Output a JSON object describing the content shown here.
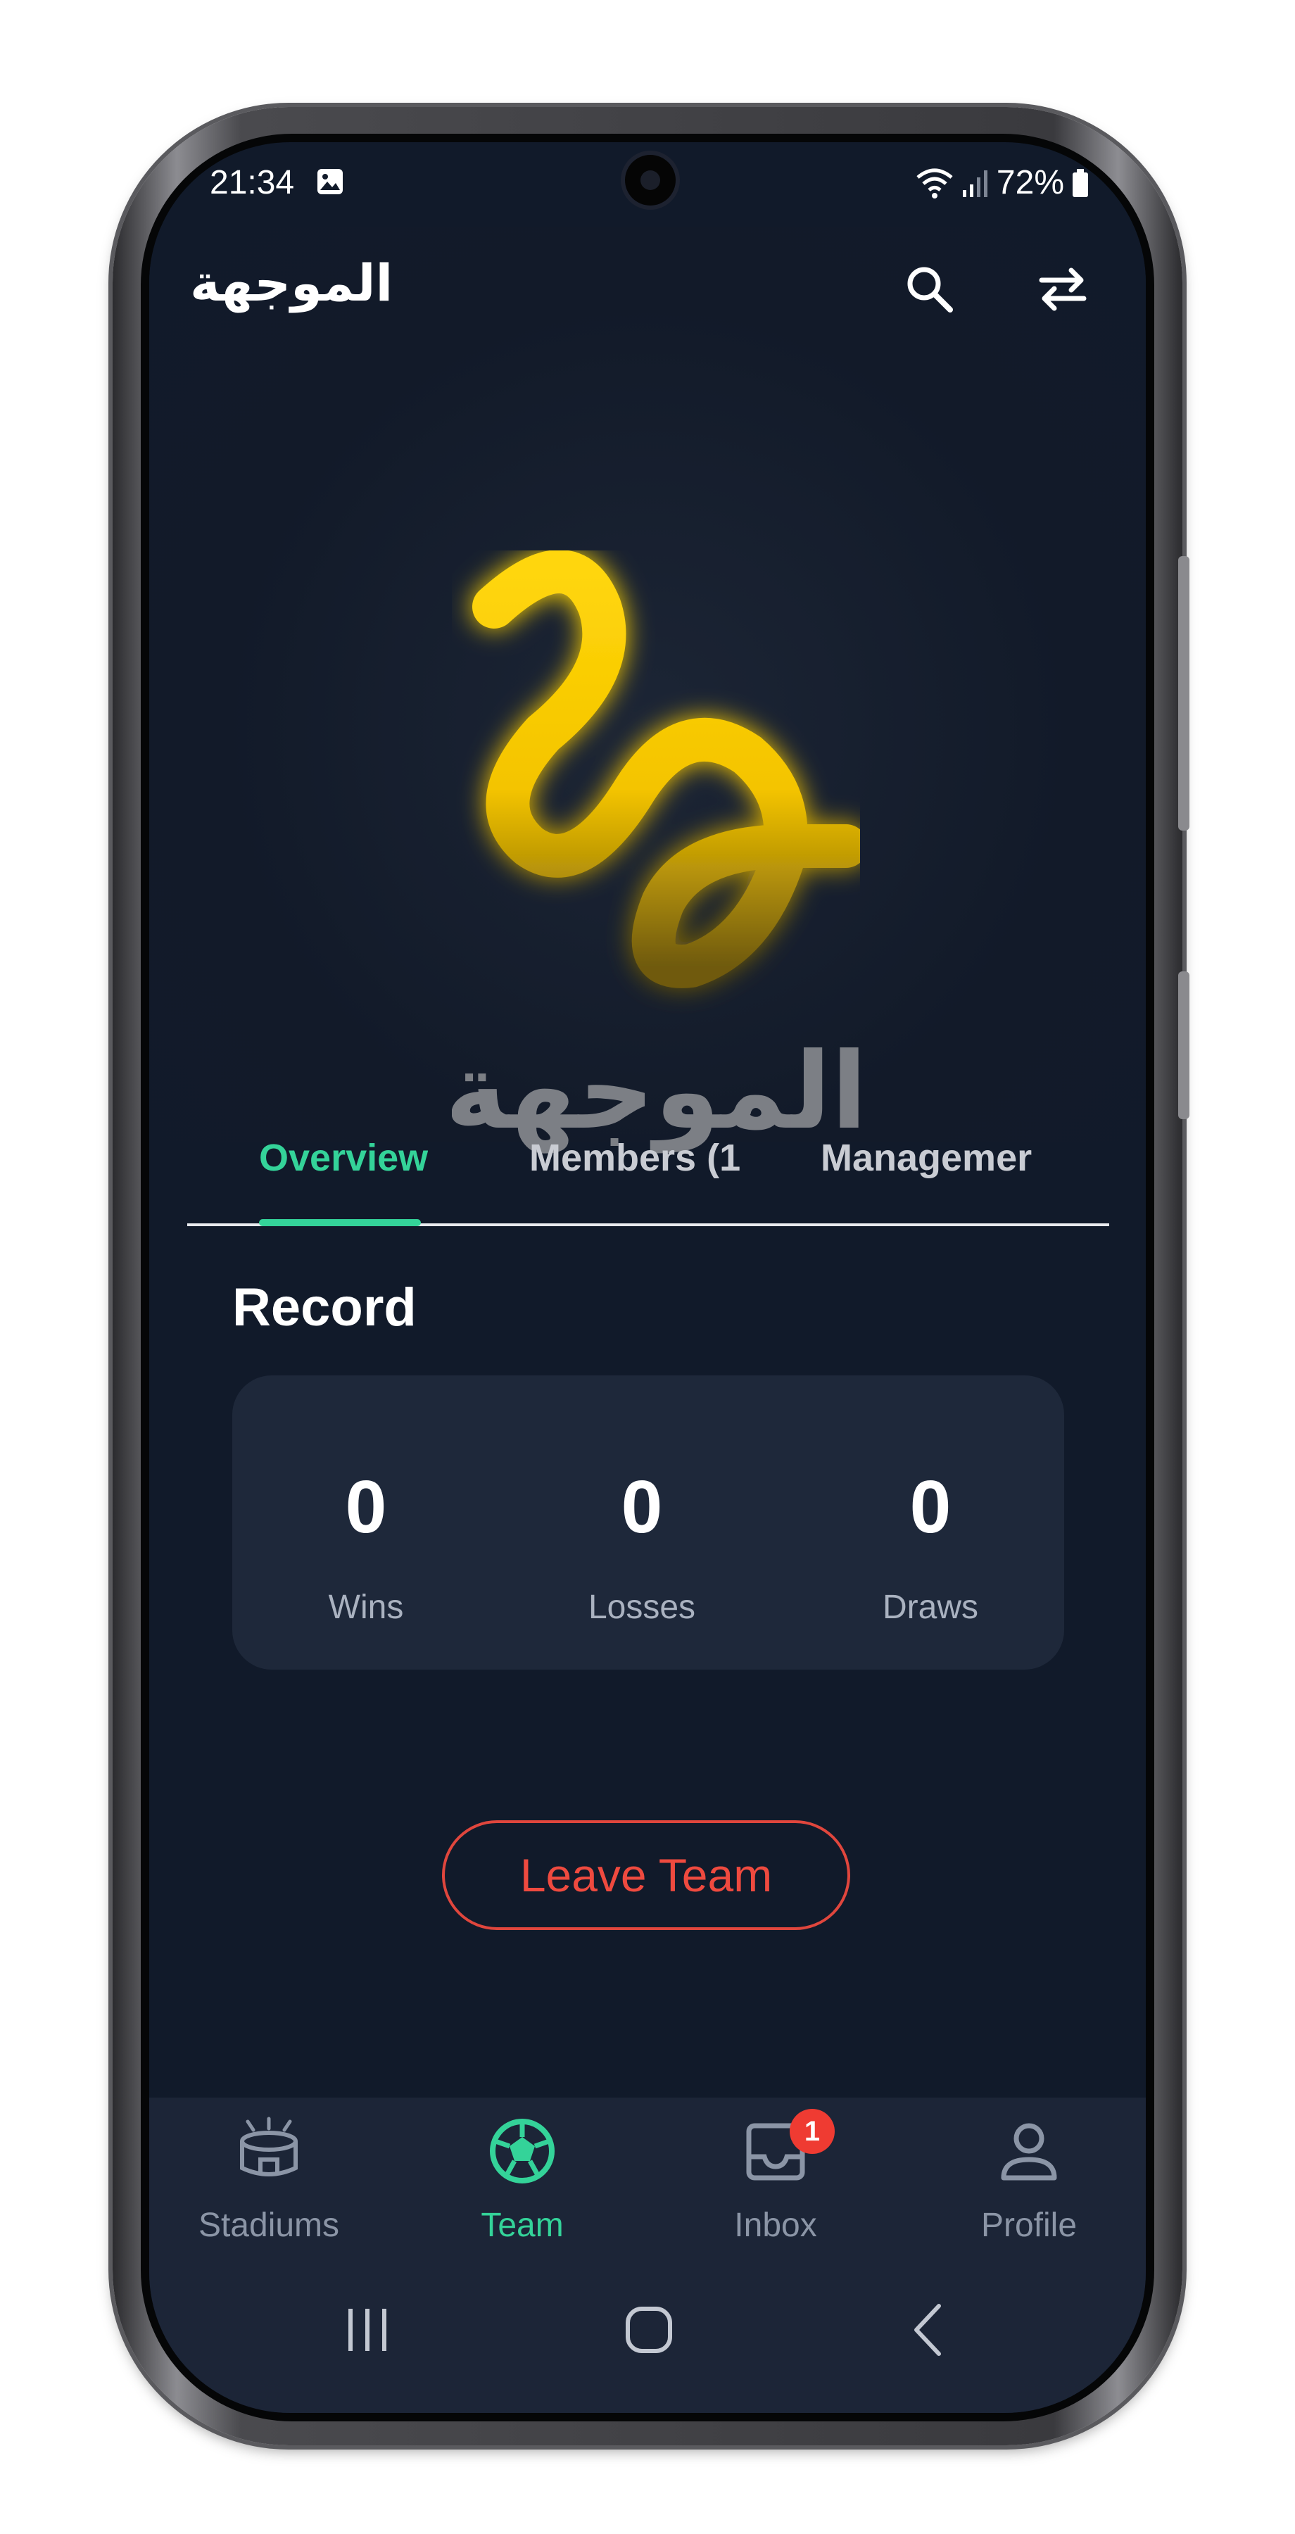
{
  "status_bar": {
    "time": "21:34",
    "battery": "72%"
  },
  "app_bar": {
    "title": "الموجهة",
    "icons": [
      "search-icon",
      "swap-icon"
    ]
  },
  "team_logo": {
    "text": "الموجهة",
    "colors": {
      "yellow": "#f4c700",
      "gray": "#7c7f85"
    }
  },
  "tabs": [
    {
      "label": "Overview",
      "active": true
    },
    {
      "label": "Members (1",
      "active": false
    },
    {
      "label": "Managemer",
      "active": false
    }
  ],
  "record": {
    "title": "Record",
    "stats": [
      {
        "value": "0",
        "label": "Wins"
      },
      {
        "value": "0",
        "label": "Losses"
      },
      {
        "value": "0",
        "label": "Draws"
      }
    ]
  },
  "leave_button": {
    "label": "Leave Team",
    "color": "#ef4a3f"
  },
  "bottom_nav": {
    "items": [
      {
        "label": "Stadiums",
        "icon": "stadium-icon",
        "active": false
      },
      {
        "label": "Team",
        "icon": "soccer-ball-icon",
        "active": true
      },
      {
        "label": "Inbox",
        "icon": "inbox-icon",
        "active": false,
        "badge": "1"
      },
      {
        "label": "Profile",
        "icon": "profile-icon",
        "active": false
      }
    ]
  },
  "system_nav": {
    "icons": [
      "recent-apps-icon",
      "home-icon",
      "back-icon"
    ]
  },
  "colors": {
    "background": "#111a2a",
    "card": "#1e283a",
    "accent": "#34d399",
    "danger": "#ef4a3f"
  }
}
